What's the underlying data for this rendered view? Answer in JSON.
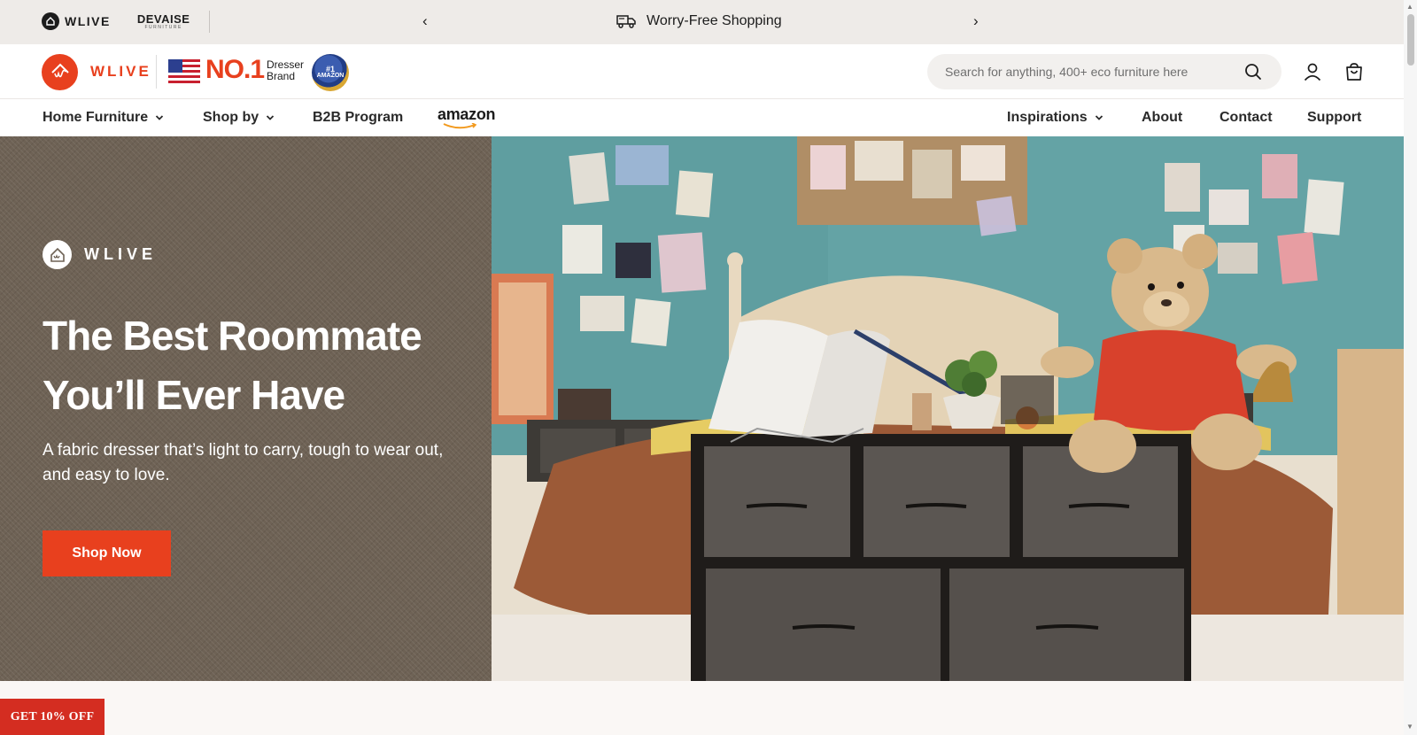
{
  "topbar": {
    "brand_primary": "WLIVE",
    "brand_secondary": "DEVAISE",
    "brand_secondary_sub": "FURNITURE",
    "announcement": "Worry-Free Shopping"
  },
  "header": {
    "logo_text": "WLIVE",
    "rank_text": "NO.1",
    "rank_sub_line1": "Dresser",
    "rank_sub_line2": "Brand",
    "badge_line1": "#1",
    "badge_line2": "AMAZON",
    "search_placeholder": "Search for anything, 400+ eco furniture here"
  },
  "nav": {
    "left": [
      {
        "label": "Home Furniture",
        "dropdown": true
      },
      {
        "label": "Shop by",
        "dropdown": true
      },
      {
        "label": "B2B Program",
        "dropdown": false
      }
    ],
    "amazon_label": "amazon",
    "right": [
      {
        "label": "Inspirations",
        "dropdown": true
      },
      {
        "label": "About",
        "dropdown": false
      },
      {
        "label": "Contact",
        "dropdown": false
      },
      {
        "label": "Support",
        "dropdown": false
      }
    ]
  },
  "hero": {
    "brand": "WLIVE",
    "title_line1": "The Best Roommate",
    "title_line2": "You’ll Ever Have",
    "subtitle": "A fabric dresser that’s light to carry, tough to wear out, and easy to love.",
    "cta_label": "Shop Now"
  },
  "promo": {
    "label": "GET 10% OFF"
  },
  "colors": {
    "accent": "#e8401e",
    "promo": "#d42d21",
    "topbar_bg": "#eeebe8",
    "hero_left_bg": "#6e6255"
  }
}
